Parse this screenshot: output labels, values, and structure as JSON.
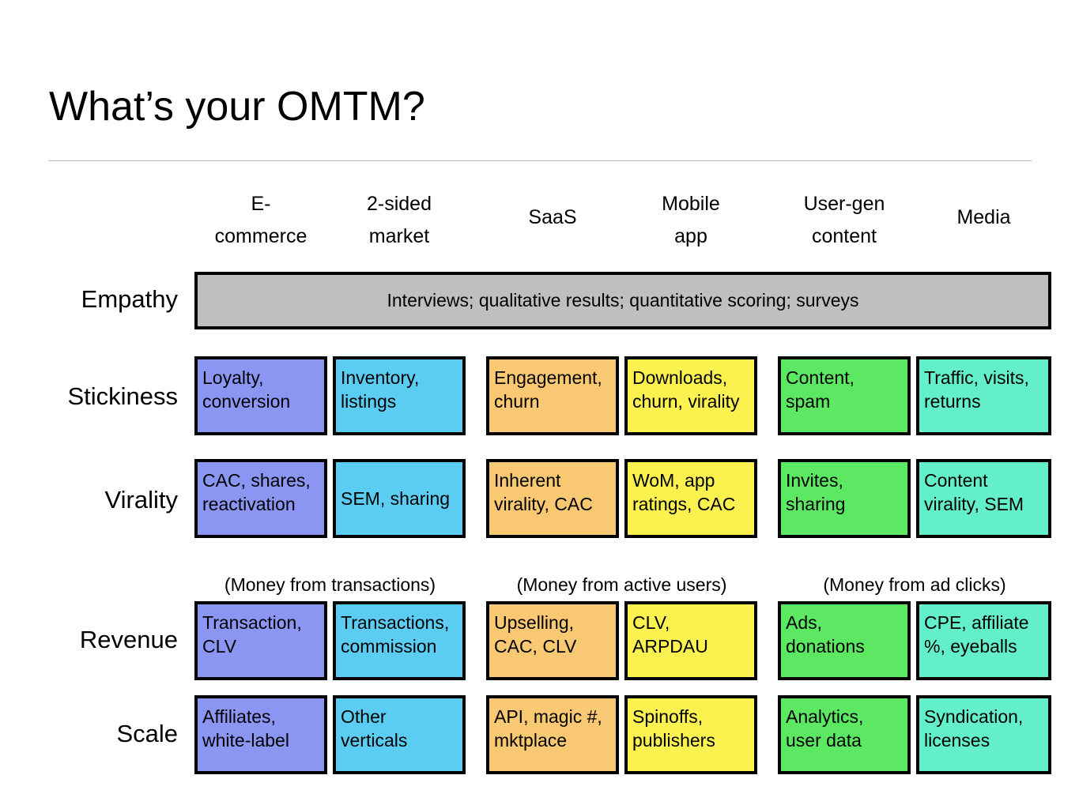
{
  "slide": {
    "title": "What’s your OMTM?"
  },
  "colors": {
    "e_commerce": "#8a96f2",
    "two_sided_market": "#5ccdf2",
    "saas": "#f8c873",
    "mobile_app": "#fbf24f",
    "user_gen_content": "#5ce863",
    "media": "#62efc9",
    "empathy_banner": "#bfbfbf",
    "border": "#000000",
    "rule": "#b5b5b5"
  },
  "chart_data": {
    "type": "table",
    "title": "What’s your OMTM?",
    "columns": [
      "E-commerce",
      "2-sided market",
      "SaaS",
      "Mobile app",
      "User-gen content",
      "Media"
    ],
    "rows": [
      "Empathy",
      "Stickiness",
      "Virality",
      "Revenue",
      "Scale"
    ],
    "empathy_spanning_cell": "Interviews; qualitative results; quantitative scoring; surveys",
    "money_notes": [
      "(Money from transactions)",
      "(Money from active users)",
      "(Money from ad clicks)"
    ],
    "cells": {
      "Stickiness": [
        "Loyalty, conversion",
        "Inventory, listings",
        "Engagement, churn",
        "Downloads, churn, virality",
        "Content, spam",
        "Traffic, visits, returns"
      ],
      "Virality": [
        "CAC, shares, reactivation",
        "SEM, sharing",
        "Inherent virality, CAC",
        "WoM, app ratings, CAC",
        "Invites, sharing",
        "Content virality, SEM"
      ],
      "Revenue": [
        "Transaction, CLV",
        "Transactions, commission",
        "Upselling, CAC, CLV",
        "CLV, ARPDAU",
        "Ads, donations",
        "CPE, affiliate %, eyeballs"
      ],
      "Scale": [
        "Affiliates, white-label",
        "Other verticals",
        "API, magic #, mktplace",
        "Spinoffs, publishers",
        "Analytics, user data",
        "Syndication, licenses"
      ]
    }
  },
  "headers": {
    "col0_line1": "E-",
    "col0_line2": "commerce",
    "col1_line1": "2-sided",
    "col1_line2": "market",
    "col2": "SaaS",
    "col3_line1": "Mobile",
    "col3_line2": "app",
    "col4_line1": "User-gen",
    "col4_line2": "content",
    "col5": "Media"
  },
  "row_labels": {
    "empathy": "Empathy",
    "stickiness": "Stickiness",
    "virality": "Virality",
    "revenue": "Revenue",
    "scale": "Scale"
  },
  "empathy": {
    "text": "Interviews; qualitative results; quantitative scoring; surveys"
  },
  "money": {
    "transactions": "(Money from transactions)",
    "active_users": "(Money from active users)",
    "ad_clicks": "(Money from ad clicks)"
  },
  "stickiness": {
    "c0_l1": "Loyalty,",
    "c0_l2": "conversion",
    "c1_l1": "Inventory,",
    "c1_l2": "listings",
    "c2_l1": "Engagement,",
    "c2_l2": "churn",
    "c3_l1": "Downloads,",
    "c3_l2": "churn, virality",
    "c4_l1": "Content,",
    "c4_l2": "spam",
    "c5_l1": "Traffic, visits,",
    "c5_l2": "returns"
  },
  "virality": {
    "c0_l1": "CAC, shares,",
    "c0_l2": "reactivation",
    "c1_l1": "SEM, sharing",
    "c1_l2": "",
    "c2_l1": "Inherent",
    "c2_l2": "virality, CAC",
    "c3_l1": "WoM, app",
    "c3_l2": "ratings, CAC",
    "c4_l1": "Invites,",
    "c4_l2": "sharing",
    "c5_l1": "Content",
    "c5_l2": "virality, SEM"
  },
  "revenue": {
    "c0_l1": "Transaction,",
    "c0_l2": "CLV",
    "c1_l1": "Transactions,",
    "c1_l2": "commission",
    "c2_l1": "Upselling,",
    "c2_l2": "CAC, CLV",
    "c3_l1": "CLV,",
    "c3_l2": "ARPDAU",
    "c4_l1": "Ads,",
    "c4_l2": "donations",
    "c5_l1": "CPE, affiliate",
    "c5_l2": "%, eyeballs"
  },
  "scale": {
    "c0_l1": "Affiliates,",
    "c0_l2": "white-label",
    "c1_l1": "Other",
    "c1_l2": "verticals",
    "c2_l1": "API, magic #,",
    "c2_l2": "mktplace",
    "c3_l1": "Spinoffs,",
    "c3_l2": "publishers",
    "c4_l1": "Analytics,",
    "c4_l2": "user data",
    "c5_l1": "Syndication,",
    "c5_l2": "licenses"
  }
}
